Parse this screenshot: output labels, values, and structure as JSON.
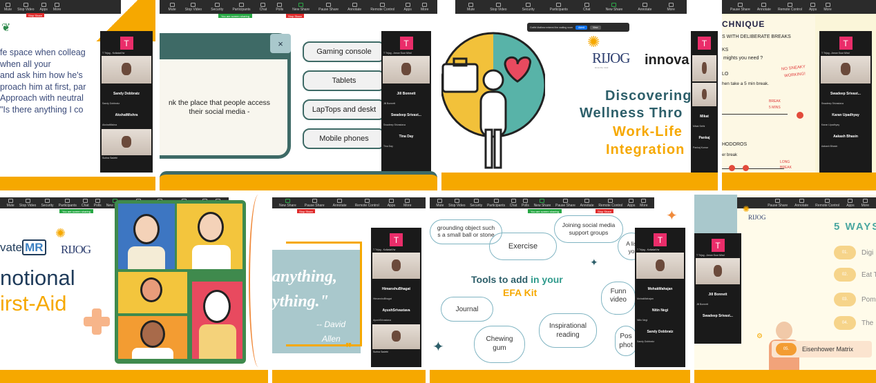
{
  "toolbar_labels": [
    "Mute",
    "Stop Video",
    "Security",
    "Participants",
    "Chat",
    "Polls",
    "New Share",
    "Pause Share",
    "Annotate",
    "Remote Control",
    "Apps",
    "More"
  ],
  "toolbar_labels_short": [
    "Mute",
    "Stop Video",
    "Security",
    "Participants",
    "Chat",
    "Polls",
    "New Share",
    "Pause Share",
    "Annotate",
    "Remote Control",
    "Apps",
    "More"
  ],
  "share_banner": "You are screen sharing",
  "stop_share": "Stop Share",
  "avatar_letter": "T",
  "tile1": {
    "lines": [
      "fe space when colleag",
      "when all your",
      "and ask him how he's",
      "proach him at first, par",
      "Approach with neutral",
      "\"Is there anything I co"
    ],
    "names": [
      "Sandy Dobbratz",
      "AkshatMishra"
    ],
    "labels": [
      "T Trijog - Kolkata/Vw",
      "Sandy Dobbratz",
      "AkshatMishra",
      "Surina Sadebi"
    ]
  },
  "tile2": {
    "question": "nk the place that people access their social media -",
    "close": "×",
    "options": [
      "Gaming console",
      "Tablets",
      "LapTops and deskt",
      "Mobile phones"
    ],
    "names": [
      "Jill Bonnett",
      "Swadeep Srivast...",
      "Tina Day"
    ],
    "labels": [
      "T Trijog - Arrow Sour Mind",
      "Jill Bonnett",
      "Swadeep Srivastava",
      "Tina Day"
    ]
  },
  "tile3": {
    "notice": "Gotthi Mathew entered the waiting room",
    "admit": "Admit",
    "view": "View",
    "logo_text": "RIJOG",
    "innova": "innova",
    "tag": "know the mind",
    "line1": "Discovering",
    "line2": "Wellness Thro",
    "line3": "Work-Life",
    "line4": "Integration",
    "names": [
      "Mikat",
      "Pankaj"
    ],
    "labels": [
      "Mikat Sethi",
      "Pankaj Kumar"
    ]
  },
  "tile4": {
    "title": "CHNIQUE",
    "l1": "S WITH DELIBERATE BREAKS",
    "l2": "KS",
    "l3": "mights you need ?",
    "l4": "LO",
    "l5": "hen take a 5 min break.",
    "l6": "NO SNEAKY",
    "l7": "WORKING!",
    "l8": "BREAK",
    "l9": "5 MINS",
    "l10": "HODOROS",
    "l11": "er break",
    "l12": "LONG",
    "l13": "BREAK",
    "names": [
      "Swadeep Srivast...",
      "Karan Upadhyay",
      "Aakash Bhasin"
    ],
    "labels": [
      "T Trijog - Arrow Sour Mind",
      "Swadeep Srivastava",
      "Karan Upadhyay",
      "Aakash Bhasin"
    ]
  },
  "tile5": {
    "brand1": "vate",
    "brand2": "MR",
    "brand3": "RIJOG",
    "title1": "notional",
    "title2": "irst-Aid"
  },
  "tile6": {
    "q1": "anything,",
    "q2": "ything.\"",
    "author1": "-- David",
    "author2": "Allen",
    "quote_mark": "❞",
    "names": [
      "HimanshuBhagat",
      "AyushSrivastava"
    ],
    "labels": [
      "T Trijog - Kolkata/Vw",
      "HimanshuBhagat",
      "AyushSrivastava",
      "Surina Sadebi"
    ]
  },
  "tile7": {
    "c1a": "grounding object such",
    "c1b": "s a small ball or stone",
    "c2": "Exercise",
    "c3a": "Joining social media",
    "c3b": "support groups",
    "c4a": "A lis",
    "c4b": "yo",
    "center1": "Tools to add ",
    "center1b": "in your",
    "center2": "EFA Kit",
    "c5": "Journal",
    "c6a": "Funn",
    "c6b": "video",
    "c7a": "Inspirational",
    "c7b": "reading",
    "c8a": "Chewing",
    "c8b": "gum",
    "c9a": "Pos",
    "c9b": "phot",
    "names": [
      "MohakMahajan",
      "Nitin Negi",
      "Sandy Dobbratz"
    ],
    "labels": [
      "T Trijog - Kolkata/Vw",
      "MohakMahajan",
      "Nitin Negi",
      "Sandy Dobbratz"
    ]
  },
  "tile8": {
    "heading": "5 WAYS T",
    "items": [
      {
        "n": "01.",
        "t": "Digi"
      },
      {
        "n": "02.",
        "t": "Eat T"
      },
      {
        "n": "03.",
        "t": "Pom"
      },
      {
        "n": "04.",
        "t": "The"
      }
    ],
    "last_n": "05.",
    "last_t": "Eisenhower Matrix",
    "brand": "RIJOG",
    "names": [
      "Jill Bonnett",
      "Swadeep Srivast..."
    ],
    "labels": [
      "T Trijog - Arrow Sour Mind",
      "Jill Bonnett"
    ]
  }
}
